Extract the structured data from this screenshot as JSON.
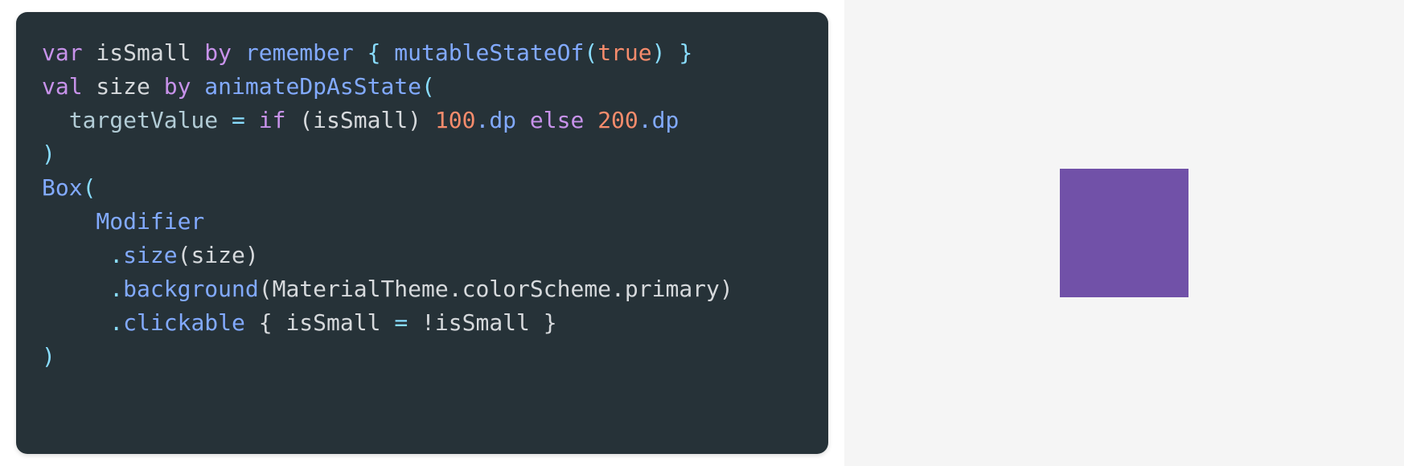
{
  "code": {
    "line1": {
      "t1": "var",
      "t2": " isSmall ",
      "t3": "by",
      "t4": " remember ",
      "t5": "{",
      "t6": " mutableStateOf",
      "t7": "(",
      "t8": "true",
      "t9": ")",
      "t10": " }"
    },
    "line2": {
      "t1": "val",
      "t2": " size ",
      "t3": "by",
      "t4": " animateDpAsState",
      "t5": "("
    },
    "line3": {
      "t1": "  targetValue ",
      "t2": "=",
      "t3": " ",
      "t4": "if",
      "t5": " (isSmall) ",
      "t6": "100",
      "t7": ".dp ",
      "t8": "else",
      "t9": " ",
      "t10": "200",
      "t11": ".dp"
    },
    "line4": {
      "t1": ")"
    },
    "line5": {
      "t1": "Box",
      "t2": "("
    },
    "line6": {
      "t1": "    Modifier"
    },
    "line7": {
      "t1": "     .",
      "t2": "size",
      "t3": "(size)"
    },
    "line8": {
      "t1": "     .",
      "t2": "background",
      "t3": "(MaterialTheme.colorScheme.primary)"
    },
    "line9": {
      "t1": "     .",
      "t2": "clickable",
      "t3": " { isSmall ",
      "t4": "=",
      "t5": " !isSmall }"
    },
    "line10": {
      "t1": ")"
    }
  },
  "preview": {
    "box_color": "#7151a8",
    "background": "#f5f5f5"
  }
}
